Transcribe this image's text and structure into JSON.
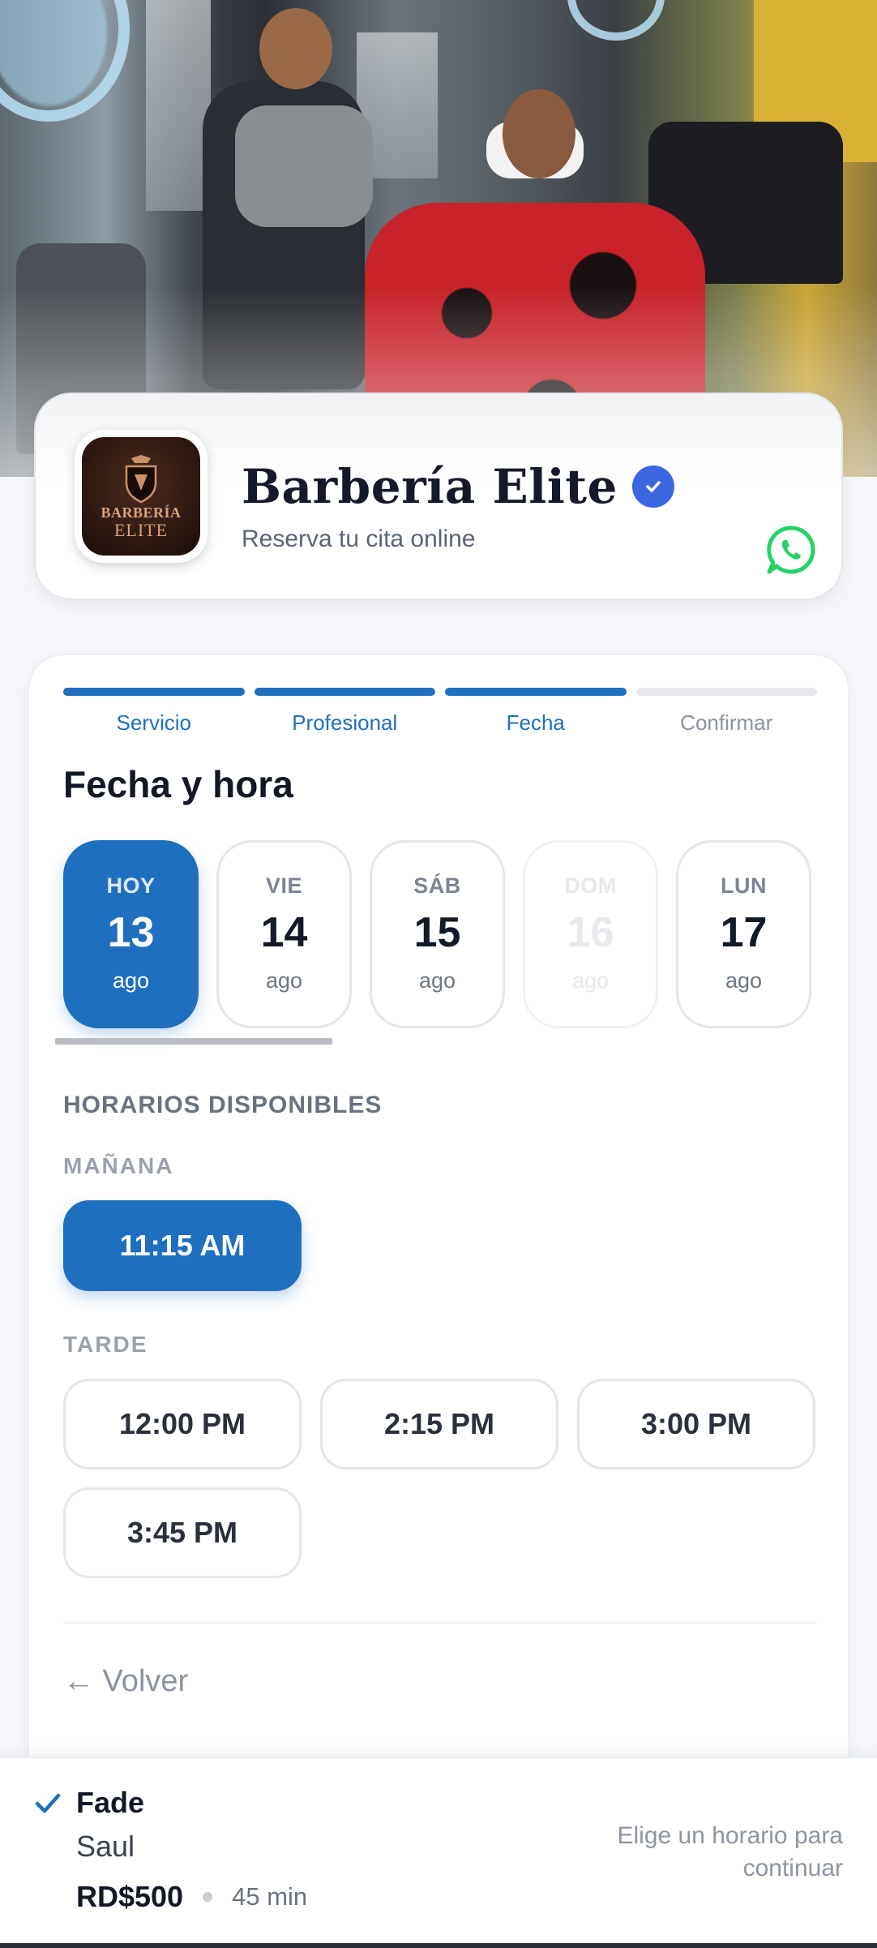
{
  "brand": {
    "name": "Barbería Elite",
    "subtitle": "Reserva tu cita online",
    "logo_line1": "BARBERÍA",
    "logo_line2": "ELITE"
  },
  "steps": [
    {
      "label": "Servicio",
      "state": "done"
    },
    {
      "label": "Profesional",
      "state": "done"
    },
    {
      "label": "Fecha",
      "state": "done"
    },
    {
      "label": "Confirmar",
      "state": "todo"
    }
  ],
  "section_title": "Fecha y hora",
  "dates": [
    {
      "weekday": "HOY",
      "day": "13",
      "month": "ago",
      "state": "selected"
    },
    {
      "weekday": "VIE",
      "day": "14",
      "month": "ago",
      "state": "available"
    },
    {
      "weekday": "SÁB",
      "day": "15",
      "month": "ago",
      "state": "available"
    },
    {
      "weekday": "DOM",
      "day": "16",
      "month": "ago",
      "state": "disabled"
    },
    {
      "weekday": "LUN",
      "day": "17",
      "month": "ago",
      "state": "available"
    }
  ],
  "slots": {
    "heading": "HORARIOS DISPONIBLES",
    "morning_label": "MAÑANA",
    "morning": [
      {
        "time": "11:15 AM",
        "selected": true
      }
    ],
    "afternoon_label": "TARDE",
    "afternoon": [
      {
        "time": "12:00 PM",
        "selected": false
      },
      {
        "time": "2:15 PM",
        "selected": false
      },
      {
        "time": "3:00 PM",
        "selected": false
      },
      {
        "time": "3:45 PM",
        "selected": false
      }
    ]
  },
  "back_label": "← Volver",
  "summary": {
    "service": "Fade",
    "professional": "Saul",
    "price": "RD$500",
    "duration": "45 min",
    "hint": "Elige un horario para continuar"
  },
  "colors": {
    "primary": "#1f6fbf",
    "verified": "#3a67e0",
    "whatsapp": "#25d366"
  },
  "icons": [
    "verified-badge-icon",
    "whatsapp-icon",
    "checkmark-icon",
    "arrow-left-icon"
  ]
}
